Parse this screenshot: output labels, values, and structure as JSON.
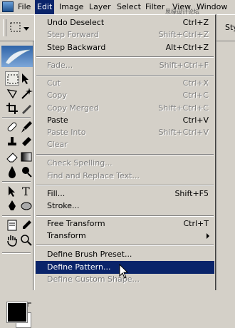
{
  "menubar": {
    "items": [
      "File",
      "Edit",
      "Image",
      "Layer",
      "Select",
      "Filter",
      "View",
      "Window"
    ],
    "active": "Edit",
    "watermark": "思缘设计论坛 www.MISSYUAN.COM"
  },
  "options_bar": {
    "style_label": "Sty"
  },
  "edit_menu": {
    "items": [
      {
        "label": "Undo Deselect",
        "shortcut": "Ctrl+Z",
        "enabled": true
      },
      {
        "label": "Step Forward",
        "shortcut": "Shift+Ctrl+Z",
        "enabled": false
      },
      {
        "label": "Step Backward",
        "shortcut": "Alt+Ctrl+Z",
        "enabled": true
      },
      {
        "label": "Fade...",
        "shortcut": "Shift+Ctrl+F",
        "enabled": false
      },
      {
        "label": "Cut",
        "shortcut": "Ctrl+X",
        "enabled": false
      },
      {
        "label": "Copy",
        "shortcut": "Ctrl+C",
        "enabled": false
      },
      {
        "label": "Copy Merged",
        "shortcut": "Shift+Ctrl+C",
        "enabled": false
      },
      {
        "label": "Paste",
        "shortcut": "Ctrl+V",
        "enabled": true
      },
      {
        "label": "Paste Into",
        "shortcut": "Shift+Ctrl+V",
        "enabled": false
      },
      {
        "label": "Clear",
        "shortcut": "",
        "enabled": false
      },
      {
        "label": "Check Spelling...",
        "shortcut": "",
        "enabled": false
      },
      {
        "label": "Find and Replace Text...",
        "shortcut": "",
        "enabled": false
      },
      {
        "label": "Fill...",
        "shortcut": "Shift+F5",
        "enabled": true
      },
      {
        "label": "Stroke...",
        "shortcut": "",
        "enabled": true
      },
      {
        "label": "Free Transform",
        "shortcut": "Ctrl+T",
        "enabled": true
      },
      {
        "label": "Transform",
        "shortcut": "",
        "enabled": true,
        "submenu": true
      },
      {
        "label": "Define Brush Preset...",
        "shortcut": "",
        "enabled": true
      },
      {
        "label": "Define Pattern...",
        "shortcut": "",
        "enabled": true,
        "highlighted": true
      },
      {
        "label": "Define Custom Shape...",
        "shortcut": "",
        "enabled": false
      }
    ]
  },
  "colors": {
    "highlight": "#0a246a",
    "chrome": "#d4d0c8",
    "disabled_text": "#808080"
  }
}
